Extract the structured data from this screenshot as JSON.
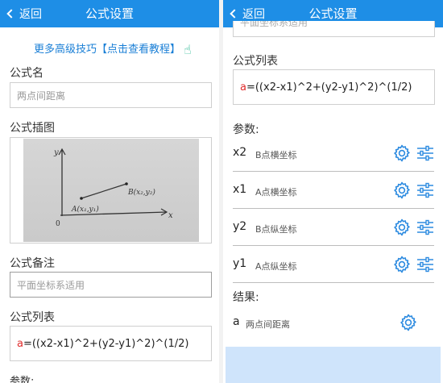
{
  "left": {
    "header": {
      "back_label": "返回",
      "title": "公式设置"
    },
    "promo": {
      "text": "更多高级技巧【点击查看教程】"
    },
    "formula_name": {
      "label": "公式名",
      "placeholder": "两点间距离"
    },
    "formula_image": {
      "label": "公式插图",
      "sketch_text": {
        "y_axis": "y",
        "x_axis": "x",
        "origin": "0",
        "point_a": "A(x₁,y₁)",
        "point_b": "B(x₂,y₂)"
      }
    },
    "formula_note": {
      "label": "公式备注",
      "placeholder": "平面坐标系适用"
    },
    "formula_list": {
      "label": "公式列表",
      "variable": "a",
      "expression": "=((x2-x1)^2+(y2-y1)^2)^(1/2)"
    },
    "params_cut_label": "参数:"
  },
  "right": {
    "header": {
      "back_label": "返回",
      "title": "公式设置"
    },
    "top_cut_text": "平面坐标系适用",
    "formula_list": {
      "label": "公式列表",
      "variable": "a",
      "expression": "=((x2-x1)^2+(y2-y1)^2)^(1/2)"
    },
    "params": {
      "label": "参数:",
      "items": [
        {
          "name": "x2",
          "desc": "B点横坐标"
        },
        {
          "name": "x1",
          "desc": "A点横坐标"
        },
        {
          "name": "y2",
          "desc": "B点纵坐标"
        },
        {
          "name": "y1",
          "desc": "A点纵坐标"
        }
      ]
    },
    "result": {
      "label": "结果:",
      "name": "a",
      "desc": "两点间距离"
    }
  },
  "icons": {
    "gear": "gear-icon",
    "sliders": "sliders-icon",
    "back": "chevron-left-icon",
    "hand": "pointing-hand-icon"
  },
  "colors": {
    "header": "#1e8ee6",
    "accent_icon": "#2d8be0",
    "variable_red": "#e02b2b",
    "promo_link": "#1a7fd6",
    "bottom_panel": "#cfe4fb"
  }
}
